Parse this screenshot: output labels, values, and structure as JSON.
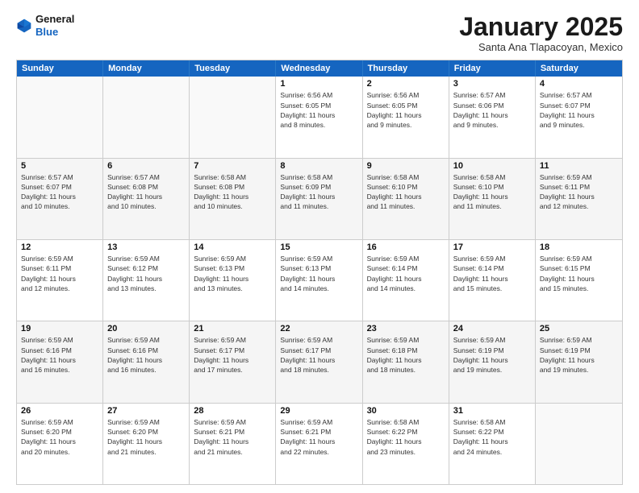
{
  "logo": {
    "line1": "General",
    "line2": "Blue"
  },
  "title": "January 2025",
  "subtitle": "Santa Ana Tlapacoyan, Mexico",
  "headers": [
    "Sunday",
    "Monday",
    "Tuesday",
    "Wednesday",
    "Thursday",
    "Friday",
    "Saturday"
  ],
  "rows": [
    [
      {
        "day": "",
        "lines": []
      },
      {
        "day": "",
        "lines": []
      },
      {
        "day": "",
        "lines": []
      },
      {
        "day": "1",
        "lines": [
          "Sunrise: 6:56 AM",
          "Sunset: 6:05 PM",
          "Daylight: 11 hours",
          "and 8 minutes."
        ]
      },
      {
        "day": "2",
        "lines": [
          "Sunrise: 6:56 AM",
          "Sunset: 6:05 PM",
          "Daylight: 11 hours",
          "and 9 minutes."
        ]
      },
      {
        "day": "3",
        "lines": [
          "Sunrise: 6:57 AM",
          "Sunset: 6:06 PM",
          "Daylight: 11 hours",
          "and 9 minutes."
        ]
      },
      {
        "day": "4",
        "lines": [
          "Sunrise: 6:57 AM",
          "Sunset: 6:07 PM",
          "Daylight: 11 hours",
          "and 9 minutes."
        ]
      }
    ],
    [
      {
        "day": "5",
        "lines": [
          "Sunrise: 6:57 AM",
          "Sunset: 6:07 PM",
          "Daylight: 11 hours",
          "and 10 minutes."
        ]
      },
      {
        "day": "6",
        "lines": [
          "Sunrise: 6:57 AM",
          "Sunset: 6:08 PM",
          "Daylight: 11 hours",
          "and 10 minutes."
        ]
      },
      {
        "day": "7",
        "lines": [
          "Sunrise: 6:58 AM",
          "Sunset: 6:08 PM",
          "Daylight: 11 hours",
          "and 10 minutes."
        ]
      },
      {
        "day": "8",
        "lines": [
          "Sunrise: 6:58 AM",
          "Sunset: 6:09 PM",
          "Daylight: 11 hours",
          "and 11 minutes."
        ]
      },
      {
        "day": "9",
        "lines": [
          "Sunrise: 6:58 AM",
          "Sunset: 6:10 PM",
          "Daylight: 11 hours",
          "and 11 minutes."
        ]
      },
      {
        "day": "10",
        "lines": [
          "Sunrise: 6:58 AM",
          "Sunset: 6:10 PM",
          "Daylight: 11 hours",
          "and 11 minutes."
        ]
      },
      {
        "day": "11",
        "lines": [
          "Sunrise: 6:59 AM",
          "Sunset: 6:11 PM",
          "Daylight: 11 hours",
          "and 12 minutes."
        ]
      }
    ],
    [
      {
        "day": "12",
        "lines": [
          "Sunrise: 6:59 AM",
          "Sunset: 6:11 PM",
          "Daylight: 11 hours",
          "and 12 minutes."
        ]
      },
      {
        "day": "13",
        "lines": [
          "Sunrise: 6:59 AM",
          "Sunset: 6:12 PM",
          "Daylight: 11 hours",
          "and 13 minutes."
        ]
      },
      {
        "day": "14",
        "lines": [
          "Sunrise: 6:59 AM",
          "Sunset: 6:13 PM",
          "Daylight: 11 hours",
          "and 13 minutes."
        ]
      },
      {
        "day": "15",
        "lines": [
          "Sunrise: 6:59 AM",
          "Sunset: 6:13 PM",
          "Daylight: 11 hours",
          "and 14 minutes."
        ]
      },
      {
        "day": "16",
        "lines": [
          "Sunrise: 6:59 AM",
          "Sunset: 6:14 PM",
          "Daylight: 11 hours",
          "and 14 minutes."
        ]
      },
      {
        "day": "17",
        "lines": [
          "Sunrise: 6:59 AM",
          "Sunset: 6:14 PM",
          "Daylight: 11 hours",
          "and 15 minutes."
        ]
      },
      {
        "day": "18",
        "lines": [
          "Sunrise: 6:59 AM",
          "Sunset: 6:15 PM",
          "Daylight: 11 hours",
          "and 15 minutes."
        ]
      }
    ],
    [
      {
        "day": "19",
        "lines": [
          "Sunrise: 6:59 AM",
          "Sunset: 6:16 PM",
          "Daylight: 11 hours",
          "and 16 minutes."
        ]
      },
      {
        "day": "20",
        "lines": [
          "Sunrise: 6:59 AM",
          "Sunset: 6:16 PM",
          "Daylight: 11 hours",
          "and 16 minutes."
        ]
      },
      {
        "day": "21",
        "lines": [
          "Sunrise: 6:59 AM",
          "Sunset: 6:17 PM",
          "Daylight: 11 hours",
          "and 17 minutes."
        ]
      },
      {
        "day": "22",
        "lines": [
          "Sunrise: 6:59 AM",
          "Sunset: 6:17 PM",
          "Daylight: 11 hours",
          "and 18 minutes."
        ]
      },
      {
        "day": "23",
        "lines": [
          "Sunrise: 6:59 AM",
          "Sunset: 6:18 PM",
          "Daylight: 11 hours",
          "and 18 minutes."
        ]
      },
      {
        "day": "24",
        "lines": [
          "Sunrise: 6:59 AM",
          "Sunset: 6:19 PM",
          "Daylight: 11 hours",
          "and 19 minutes."
        ]
      },
      {
        "day": "25",
        "lines": [
          "Sunrise: 6:59 AM",
          "Sunset: 6:19 PM",
          "Daylight: 11 hours",
          "and 19 minutes."
        ]
      }
    ],
    [
      {
        "day": "26",
        "lines": [
          "Sunrise: 6:59 AM",
          "Sunset: 6:20 PM",
          "Daylight: 11 hours",
          "and 20 minutes."
        ]
      },
      {
        "day": "27",
        "lines": [
          "Sunrise: 6:59 AM",
          "Sunset: 6:20 PM",
          "Daylight: 11 hours",
          "and 21 minutes."
        ]
      },
      {
        "day": "28",
        "lines": [
          "Sunrise: 6:59 AM",
          "Sunset: 6:21 PM",
          "Daylight: 11 hours",
          "and 21 minutes."
        ]
      },
      {
        "day": "29",
        "lines": [
          "Sunrise: 6:59 AM",
          "Sunset: 6:21 PM",
          "Daylight: 11 hours",
          "and 22 minutes."
        ]
      },
      {
        "day": "30",
        "lines": [
          "Sunrise: 6:58 AM",
          "Sunset: 6:22 PM",
          "Daylight: 11 hours",
          "and 23 minutes."
        ]
      },
      {
        "day": "31",
        "lines": [
          "Sunrise: 6:58 AM",
          "Sunset: 6:22 PM",
          "Daylight: 11 hours",
          "and 24 minutes."
        ]
      },
      {
        "day": "",
        "lines": []
      }
    ]
  ]
}
